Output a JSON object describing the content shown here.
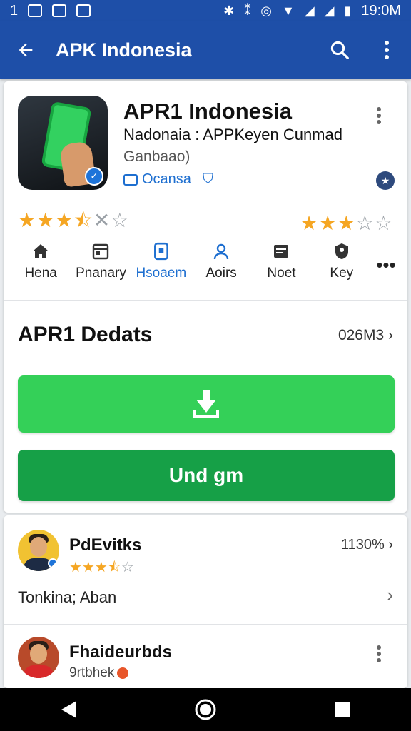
{
  "status_bar": {
    "left_number": "1",
    "time": "19:0M"
  },
  "app_bar": {
    "title": "APK Indonesia",
    "back_icon": "arrow-left-icon",
    "search_icon": "search-icon",
    "menu_icon": "more-vert-icon"
  },
  "app": {
    "name": "APR1 Indonesia",
    "developer": "Nadonaia : APPKeyen Cunmad",
    "subtitle": "Ganbaao)",
    "tag": "Ocansa",
    "rating_left": 3.5,
    "rating_right": 3
  },
  "categories": [
    {
      "label": "Hena",
      "icon": "home-icon",
      "active": false
    },
    {
      "label": "Pnanary",
      "icon": "calendar-icon",
      "active": false
    },
    {
      "label": "Hsoaem",
      "icon": "device-icon",
      "active": true
    },
    {
      "label": "Aoirs",
      "icon": "person-icon",
      "active": false
    },
    {
      "label": "Noet",
      "icon": "id-card-icon",
      "active": false
    },
    {
      "label": "Key",
      "icon": "badge-icon",
      "active": false
    }
  ],
  "details": {
    "title": "APR1 Dedats",
    "size": "026M3",
    "download_icon": "download-icon",
    "open_label": "Und gm"
  },
  "reviews": [
    {
      "name": "PdEvitks",
      "rating": 3.5,
      "count": "1130%",
      "text": "Tonkina; Aban"
    },
    {
      "name": "Fhaideurbds",
      "sub": "9rtbhek"
    }
  ],
  "colors": {
    "brand_blue": "#1e4fa8",
    "download_green": "#34d058",
    "open_green": "#16a047",
    "star": "#f5a623",
    "accent": "#1e6fd0"
  }
}
